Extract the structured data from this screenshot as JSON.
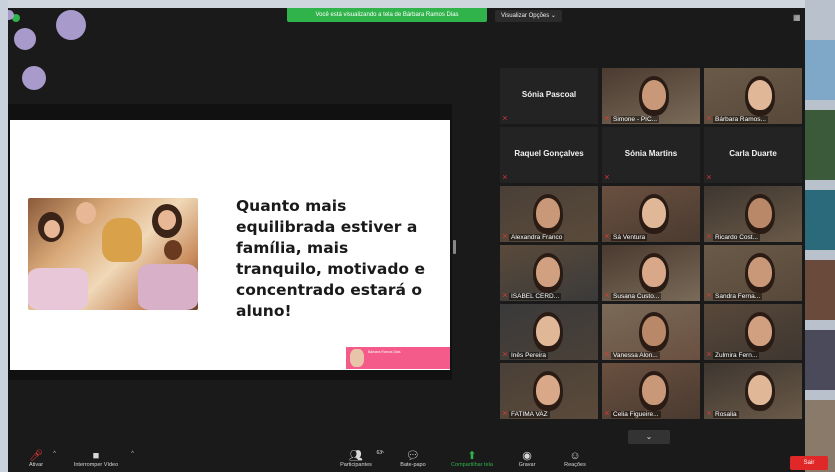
{
  "banner": {
    "sharing_text": "Você está visualizando a tela de Bárbara Ramos Dias"
  },
  "view_options": {
    "label": "Visualizar Opções",
    "caret": "⌄"
  },
  "slide": {
    "headline": [
      "Quanto mais",
      "equilibrada estiver a",
      "família, mais",
      "tranquilo, motivado e",
      "concentrado estará o",
      "aluno!"
    ],
    "logo_name": "Bárbara Ramos Dias"
  },
  "participants": [
    {
      "name": "Sónia Pascoal",
      "video": false
    },
    {
      "name": "Simone - PIC...",
      "video": true
    },
    {
      "name": "Bárbara Ramos...",
      "video": true,
      "active": true
    },
    {
      "name": "Raquel Gonçalves",
      "video": false
    },
    {
      "name": "Sónia Martins",
      "video": false
    },
    {
      "name": "Carla Duarte",
      "video": false
    },
    {
      "name": "Alexandra Franco",
      "video": true
    },
    {
      "name": "Sá Ventura",
      "video": true
    },
    {
      "name": "Ricardo Cost...",
      "video": true
    },
    {
      "name": "ISABEL CERD...",
      "video": true
    },
    {
      "name": "Susana Custo...",
      "video": true
    },
    {
      "name": "Sandra Ferna...",
      "video": true
    },
    {
      "name": "Inês Pereira",
      "video": true
    },
    {
      "name": "Vanessa Alon...",
      "video": true
    },
    {
      "name": "Zulmira Fern...",
      "video": true
    },
    {
      "name": "FATIMA VAZ",
      "video": true
    },
    {
      "name": "Celia Figueire...",
      "video": true
    },
    {
      "name": "Rosalia",
      "video": true
    }
  ],
  "expand_icon": "⌄",
  "toolbar": {
    "mute_label": "Ativar",
    "video_label": "Interromper Vídeo",
    "participants_label": "Participantes",
    "participants_count": "63",
    "chat_label": "Bate-papo",
    "share_label": "Compartilhar tela",
    "record_label": "Gravar",
    "reactions_label": "Reações",
    "leave_label": "Sair"
  },
  "colors": {
    "banner_green": "#2fb34a",
    "leave_red": "#e02828",
    "active_speaker": "#c8e24a",
    "slide_logo_pink": "#f45a8a",
    "decoration_lilac": "#b9a8e0"
  }
}
